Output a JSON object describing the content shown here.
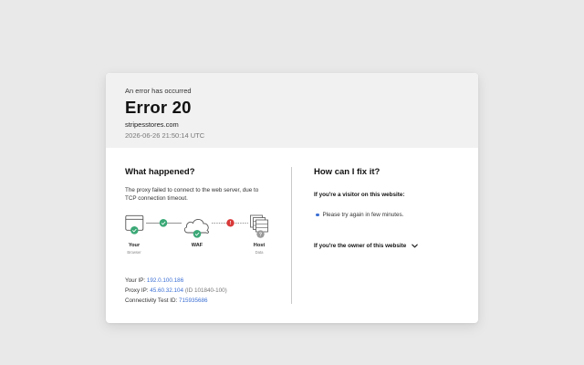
{
  "header": {
    "subtitle": "An error has occurred",
    "title": "Error 20",
    "domain": "stripesstores.com",
    "timestamp": "2026-06-26 21:50:14 UTC"
  },
  "what_happened": {
    "heading": "What happened?",
    "description": "The proxy failed to connect to the web server, due to TCP connection timeout.",
    "diagram": {
      "nodes": [
        {
          "label": "Your",
          "sublabel": "Browser",
          "status": "ok",
          "icon": "browser-icon"
        },
        {
          "label": "WAF",
          "sublabel": "",
          "status": "ok",
          "icon": "cloud-icon"
        },
        {
          "label": "Host",
          "sublabel": "Data",
          "status": "unknown",
          "icon": "server-icon"
        }
      ],
      "links": [
        {
          "status": "ok"
        },
        {
          "status": "error"
        }
      ],
      "colors": {
        "ok": "#3aa876",
        "error": "#d93a3a",
        "unknown": "#9a9a9a",
        "line": "#555555"
      }
    },
    "info": {
      "ip_label": "Your IP:",
      "ip_value": "192.0.100.186",
      "proxy_label": "Proxy IP:",
      "proxy_value": "45.60.32.104",
      "proxy_id": "(ID 101840-100)",
      "test_label": "Connectivity Test ID:",
      "test_value": "715935686"
    }
  },
  "fix": {
    "heading": "How can I fix it?",
    "visitor_heading": "If you're a visitor on this website:",
    "visitor_tip": "Please try again in few minutes.",
    "owner_heading": "If you're the owner of this website",
    "owner_icon": "chevron-down-icon"
  },
  "colors": {
    "link": "#3b6fd4",
    "header_bg": "#f1f1f1",
    "page_bg": "#e9e9e9"
  }
}
